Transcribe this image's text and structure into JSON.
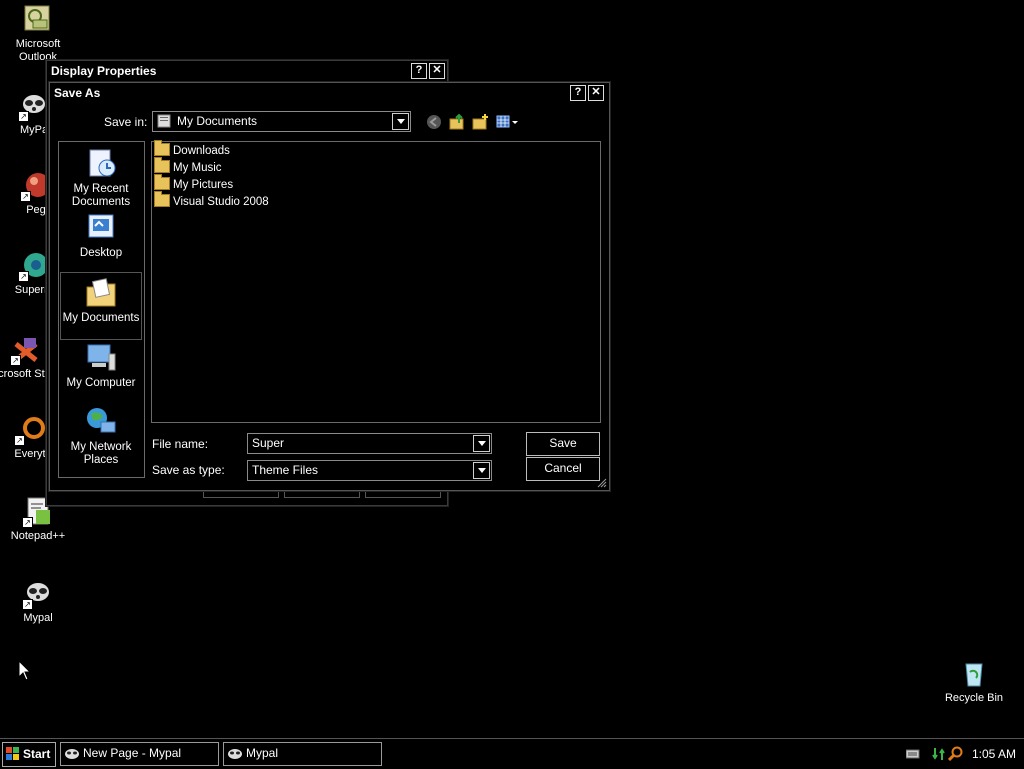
{
  "desktop": {
    "icons": [
      {
        "label": "Microsoft Outlook",
        "icon": "outlook-icon"
      },
      {
        "label": "MyPa",
        "icon": "mypal-icon"
      },
      {
        "label": "Peg",
        "icon": "pegasus-icon"
      },
      {
        "label": "Superm",
        "icon": "supermium-icon"
      },
      {
        "label": "Microsoft Studio",
        "icon": "visual-studio-icon"
      },
      {
        "label": "Everyt",
        "icon": "everything-icon"
      },
      {
        "label": "Notepad++",
        "icon": "notepadpp-icon"
      },
      {
        "label": "Mypal",
        "icon": "mypal-icon"
      },
      {
        "label": "Recycle Bin",
        "icon": "recycle-bin-icon"
      }
    ]
  },
  "display_properties": {
    "title": "Display Properties",
    "help_glyph": "?",
    "close_glyph": "✕"
  },
  "save_as": {
    "title": "Save As",
    "help_glyph": "?",
    "close_glyph": "✕",
    "save_in_label": "Save in:",
    "save_in_value": "My Documents",
    "places": [
      {
        "label": "My Recent Documents",
        "icon": "recent-documents-icon"
      },
      {
        "label": "Desktop",
        "icon": "desktop-icon"
      },
      {
        "label": "My Documents",
        "icon": "my-documents-icon"
      },
      {
        "label": "My Computer",
        "icon": "my-computer-icon"
      },
      {
        "label": "My Network Places",
        "icon": "network-places-icon"
      }
    ],
    "files": [
      {
        "name": "Downloads"
      },
      {
        "name": "My Music"
      },
      {
        "name": "My Pictures"
      },
      {
        "name": "Visual Studio 2008"
      }
    ],
    "file_name_label": "File name:",
    "file_name_value": "Super",
    "save_type_label": "Save as type:",
    "save_type_value": "Theme Files",
    "save_button": "Save",
    "cancel_button": "Cancel"
  },
  "taskbar": {
    "start_label": "Start",
    "tasks": [
      {
        "label": "New Page - Mypal"
      },
      {
        "label": "Mypal"
      }
    ],
    "clock": "1:05 AM"
  },
  "colors": {
    "background": "#000000",
    "text": "#ffffff",
    "border": "#8a8a8a"
  }
}
